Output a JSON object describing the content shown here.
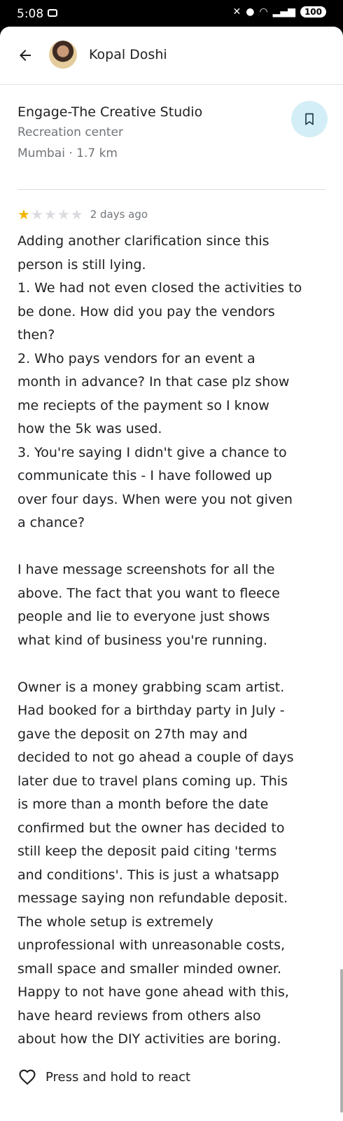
{
  "status_bar": {
    "time": "5:08",
    "battery": "100",
    "icons": [
      "notification-icon",
      "mute-icon",
      "location-icon",
      "wifi-icon",
      "signal-icon",
      "battery-icon"
    ]
  },
  "header": {
    "author_name": "Kopal Doshi",
    "back_icon": "back-arrow-icon",
    "avatar": "user-avatar"
  },
  "place": {
    "name": "Engage-The Creative Studio",
    "category": "Recreation center",
    "location": "Mumbai · 1.7 km",
    "save_icon": "bookmark-icon"
  },
  "review": {
    "rating": 1,
    "max_rating": 5,
    "date": "2 days ago",
    "text": "Adding another clarification since this\nperson is still lying.\n1. We had not even closed the activities to\nbe done. How did you pay the vendors\nthen?\n2. Who pays vendors for an event a\nmonth in advance? In that case plz show\nme reciepts of the payment so I know\nhow the 5k was used.\n3. You're saying I didn't give a chance to\ncommunicate this - I have followed up\nover four days. When were you not given\na chance?\n\nI have message screenshots for all the\nabove. The fact that you want to fleece\npeople and lie to everyone just shows\nwhat kind of business you're running.\n\nOwner is a money grabbing scam artist.\nHad booked for a birthday party in July -\ngave the deposit on 27th may and\ndecided to not go ahead a couple of days\nlater due to travel plans coming up. This\nis more than a month before the date\nconfirmed but the owner has decided to\nstill keep the deposit paid citing 'terms\nand conditions'. This is just a whatsapp\nmessage saying non refundable deposit.\nThe whole setup is extremely\nunprofessional with unreasonable costs,\nsmall space and smaller minded owner.\nHappy to not have gone ahead with this,\nhave heard reviews from others also\nabout how the DIY activities are boring."
  },
  "react": {
    "label": "Press and hold to react",
    "icon": "heart-icon"
  },
  "colors": {
    "star_filled": "#f4b400",
    "star_empty": "#dadce0",
    "save_bg": "#d3eef6",
    "secondary_text": "#70757a"
  }
}
